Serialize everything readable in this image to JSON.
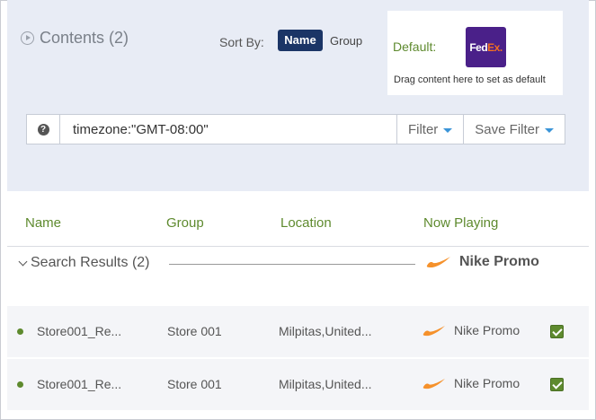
{
  "header": {
    "title": "Contents (2)",
    "sort_by_label": "Sort By:",
    "sort_options": [
      "Name",
      "Group"
    ],
    "sort_selected": "Name"
  },
  "default_box": {
    "label": "Default:",
    "logo_text_fed": "Fed",
    "logo_text_ex": "Ex",
    "logo_text_dot": ".",
    "hint": "Drag content here to set as default"
  },
  "filter": {
    "help_icon": "?",
    "value": "timezone:\"GMT-08:00\"",
    "filter_label": "Filter",
    "save_filter_label": "Save Filter"
  },
  "table": {
    "columns": [
      "Name",
      "Group",
      "Location",
      "Now Playing"
    ],
    "group_row": {
      "label": "Search Results (2)",
      "now_playing": "Nike Promo"
    },
    "rows": [
      {
        "name": "Store001_Re...",
        "group": "Store 001",
        "location": "Milpitas,United...",
        "now_playing": "Nike Promo",
        "checked": true
      },
      {
        "name": "Store001_Re...",
        "group": "Store 001",
        "location": "Milpitas,United...",
        "now_playing": "Nike Promo",
        "checked": true
      }
    ]
  },
  "colors": {
    "accent_green": "#5e8a2e",
    "navy": "#1b3566",
    "panel_bg": "#e8ecf5",
    "nike_orange": "#f5912b"
  },
  "icons": [
    "play-circle-icon",
    "help-icon",
    "caret-down-icon",
    "chevron-down-icon",
    "nike-swoosh-icon",
    "checkbox-checked-icon"
  ]
}
